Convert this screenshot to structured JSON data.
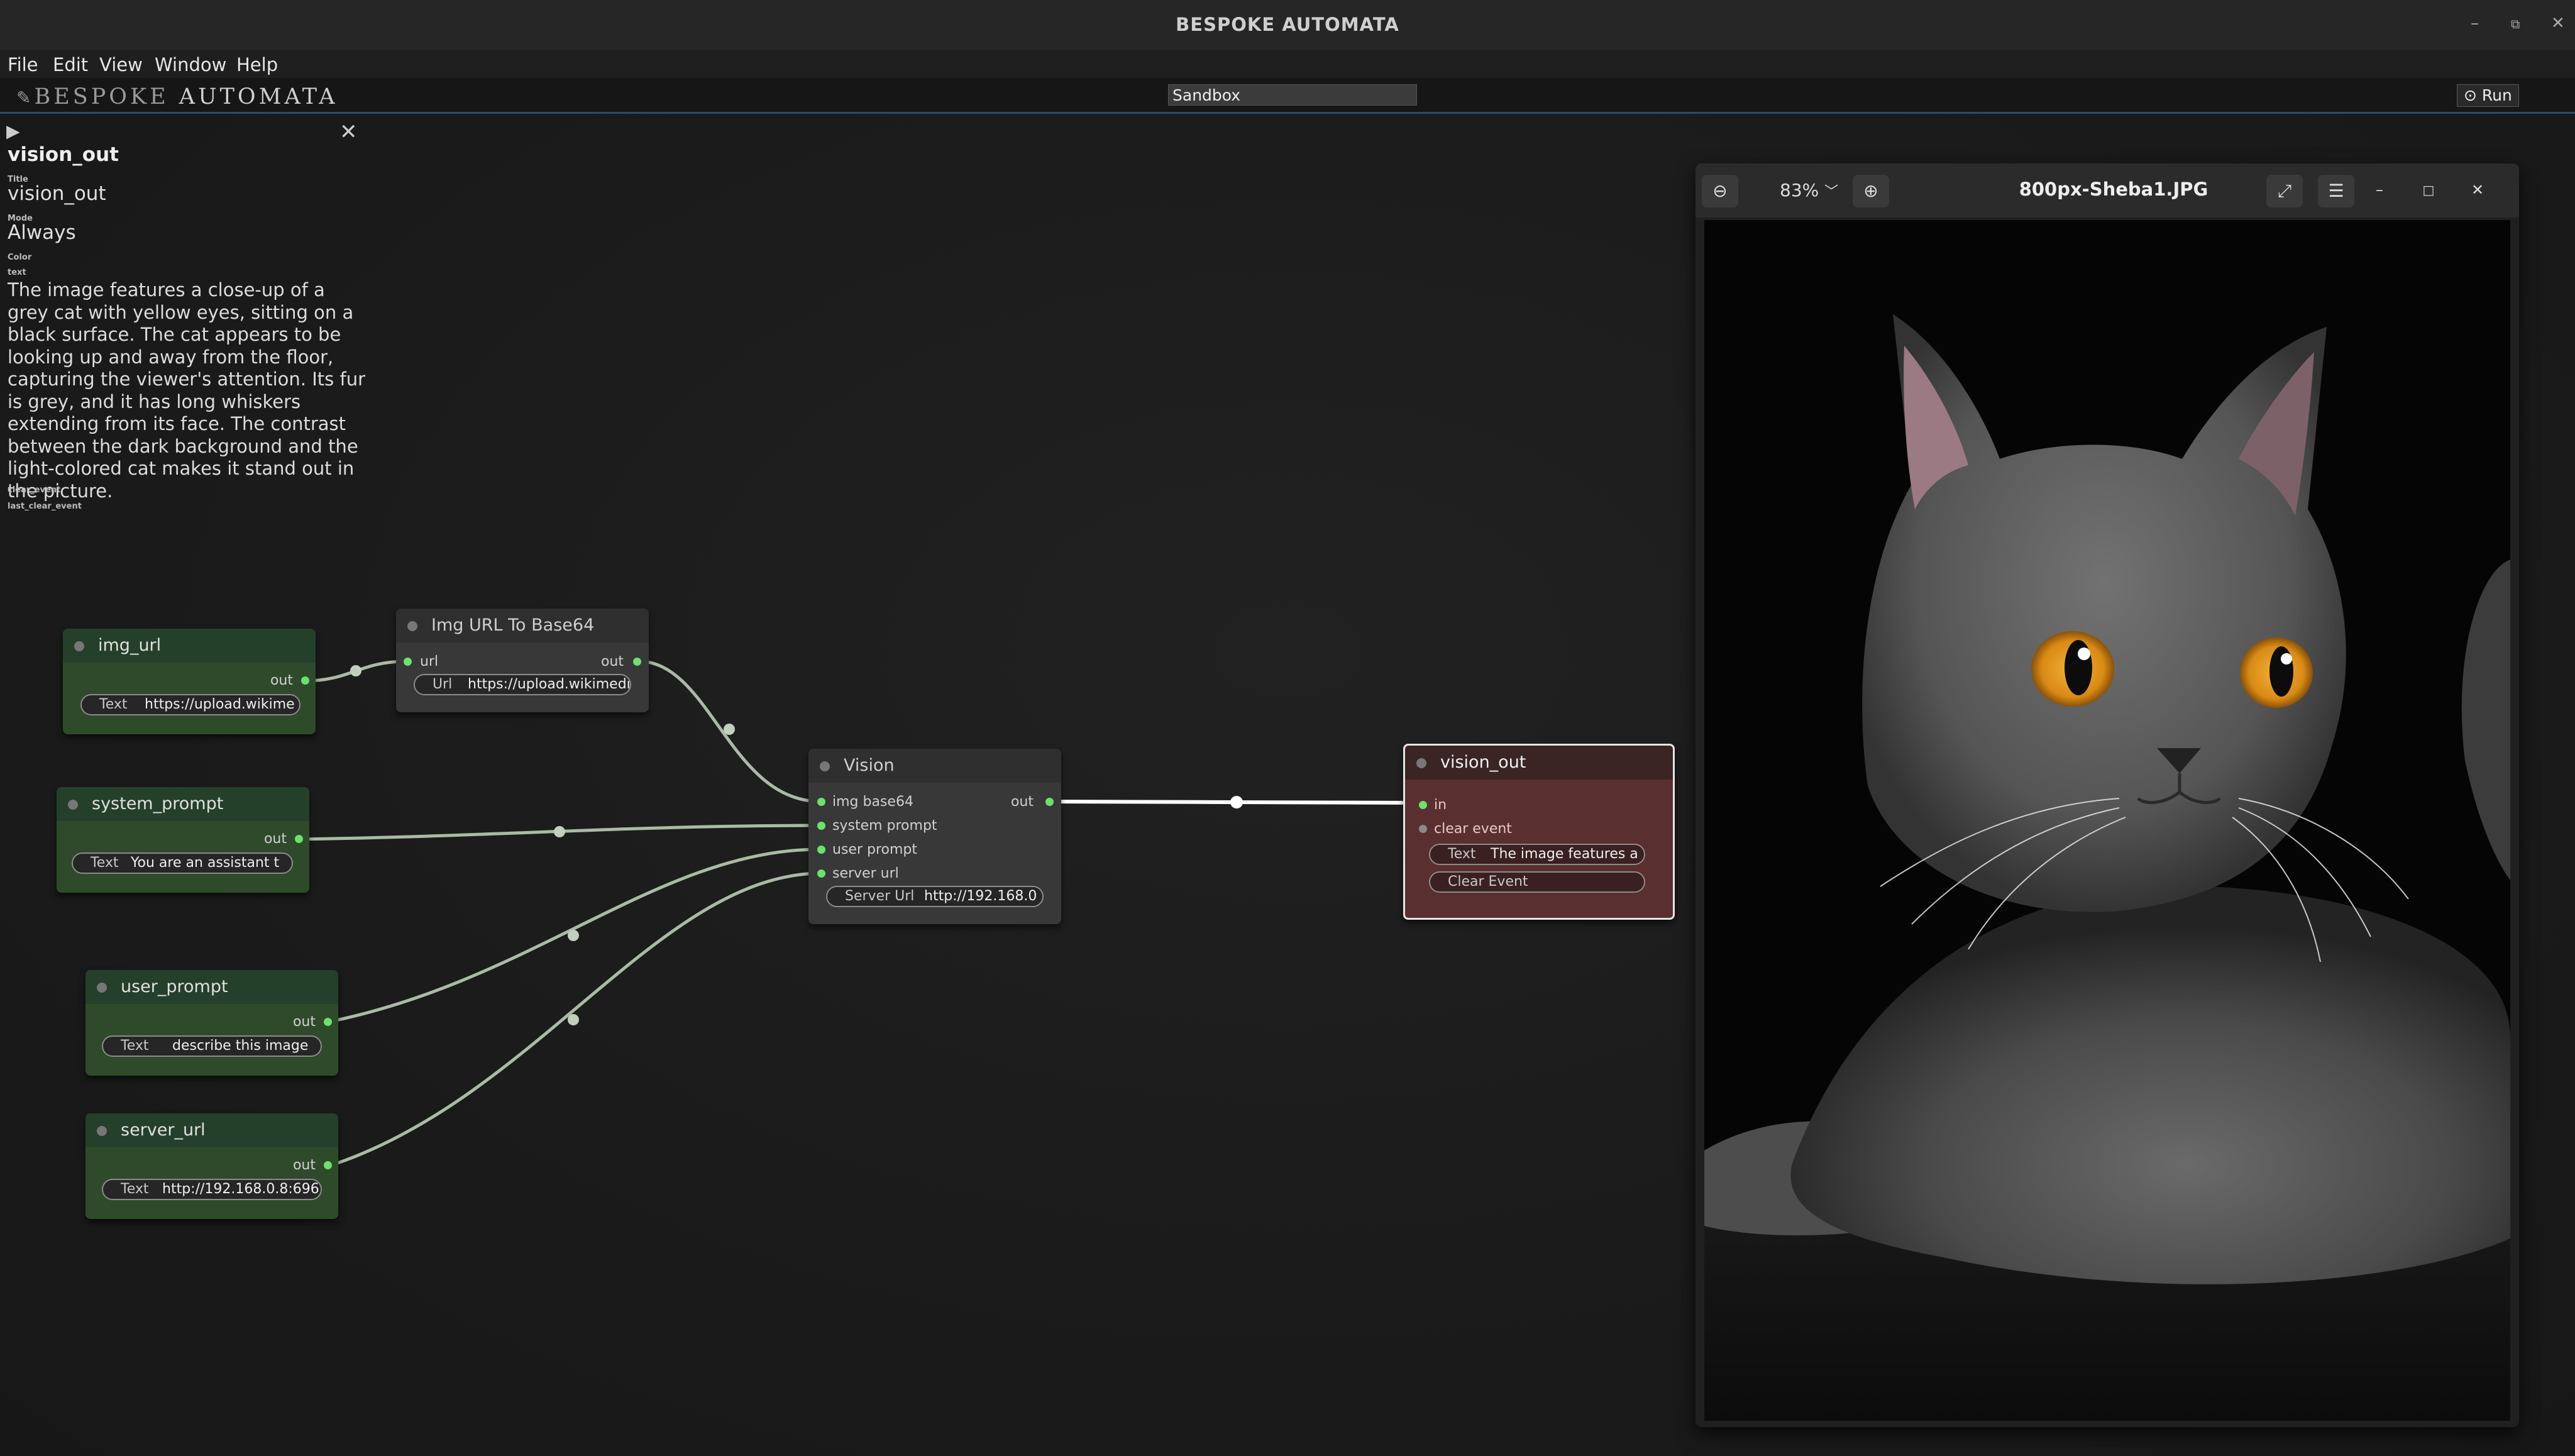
{
  "window": {
    "title": "BESPOKE AUTOMATA",
    "minimize_icon": "minimize-icon",
    "restore_icon": "restore-icon",
    "close_icon": "close-icon"
  },
  "menu": [
    "File",
    "Edit",
    "View",
    "Window",
    "Help"
  ],
  "toolbar": {
    "logo_part1": "BESPOKE",
    "logo_part2": "AUTOMATA",
    "sandbox_value": "Sandbox",
    "run_label": "Run"
  },
  "inspector": {
    "node_name": "vision_out",
    "title_label": "Title",
    "title_value": "vision_out",
    "mode_label": "Mode",
    "mode_value": "Always",
    "color_label": "Color",
    "text_label": "text",
    "text_value": "The image features a close-up of a grey cat with yellow eyes, sitting on a black surface. The cat appears to be looking up and away from the floor, capturing the viewer's attention. Its fur is grey, and it has long whiskers extending from its face. The contrast between the dark background and the light-colored cat makes it stand out in the picture.",
    "clear_event_label": "clear_event",
    "last_clear_event_label": "last_clear_event"
  },
  "nodes": {
    "img_url": {
      "title": "img_url",
      "out": "out",
      "field_label": "Text",
      "field_value": "https://upload.wikime"
    },
    "img_to_b64": {
      "title": "Img URL To Base64",
      "in": "url",
      "out": "out",
      "field_label": "Url",
      "field_value": "https://upload.wikimedi"
    },
    "system_prompt": {
      "title": "system_prompt",
      "out": "out",
      "field_label": "Text",
      "field_value": "You are an assistant t"
    },
    "user_prompt": {
      "title": "user_prompt",
      "out": "out",
      "field_label": "Text",
      "field_value": "describe this image"
    },
    "server_url": {
      "title": "server_url",
      "out": "out",
      "field_label": "Text",
      "field_value": "http://192.168.0.8:696"
    },
    "vision": {
      "title": "Vision",
      "inputs": [
        "img base64",
        "system prompt",
        "user prompt",
        "server url"
      ],
      "out": "out",
      "field_label": "Server Url",
      "field_value": "http://192.168.0"
    },
    "vision_out": {
      "title": "vision_out",
      "inputs": [
        "in",
        "clear event"
      ],
      "field_label": "Text",
      "field_value": "The image features a",
      "button_label": "Clear Event"
    }
  },
  "colors": {
    "green_node": "#2f4a2b",
    "gray_node": "#383838",
    "red_node": "#5a2f2f",
    "pin_active": "#6be26b",
    "wire": "#9fb39c",
    "wire_active": "#ffffff",
    "toolbar_accent": "#2b4a6f"
  },
  "viewer": {
    "zoom": "83%",
    "filename": "800px-Sheba1.JPG",
    "zoom_out_icon": "zoom-out-icon",
    "zoom_in_icon": "zoom-in-icon",
    "fullscreen_icon": "fullscreen-icon",
    "menu_icon": "hamburger-menu-icon",
    "image_subject": "grey cat with orange eyes on black background"
  }
}
